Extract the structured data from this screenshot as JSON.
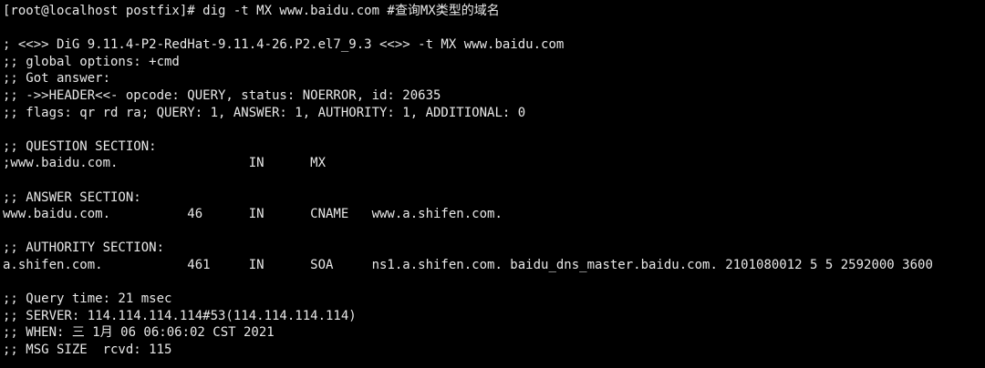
{
  "terminal": {
    "text_color": "#e8e8e8",
    "background_color": "#000000",
    "lines": [
      "[root@localhost postfix]# dig -t MX www.baidu.com #查询MX类型的域名",
      "",
      "; <<>> DiG 9.11.4-P2-RedHat-9.11.4-26.P2.el7_9.3 <<>> -t MX www.baidu.com",
      ";; global options: +cmd",
      ";; Got answer:",
      ";; ->>HEADER<<- opcode: QUERY, status: NOERROR, id: 20635",
      ";; flags: qr rd ra; QUERY: 1, ANSWER: 1, AUTHORITY: 1, ADDITIONAL: 0",
      "",
      ";; QUESTION SECTION:",
      ";www.baidu.com.                 IN      MX",
      "",
      ";; ANSWER SECTION:",
      "www.baidu.com.          46      IN      CNAME   www.a.shifen.com.",
      "",
      ";; AUTHORITY SECTION:",
      "a.shifen.com.           461     IN      SOA     ns1.a.shifen.com. baidu_dns_master.baidu.com. 2101080012 5 5 2592000 3600",
      "",
      ";; Query time: 21 msec",
      ";; SERVER: 114.114.114.114#53(114.114.114.114)",
      ";; WHEN: 三 1月 06 06:06:02 CST 2021",
      ";; MSG SIZE  rcvd: 115"
    ]
  }
}
